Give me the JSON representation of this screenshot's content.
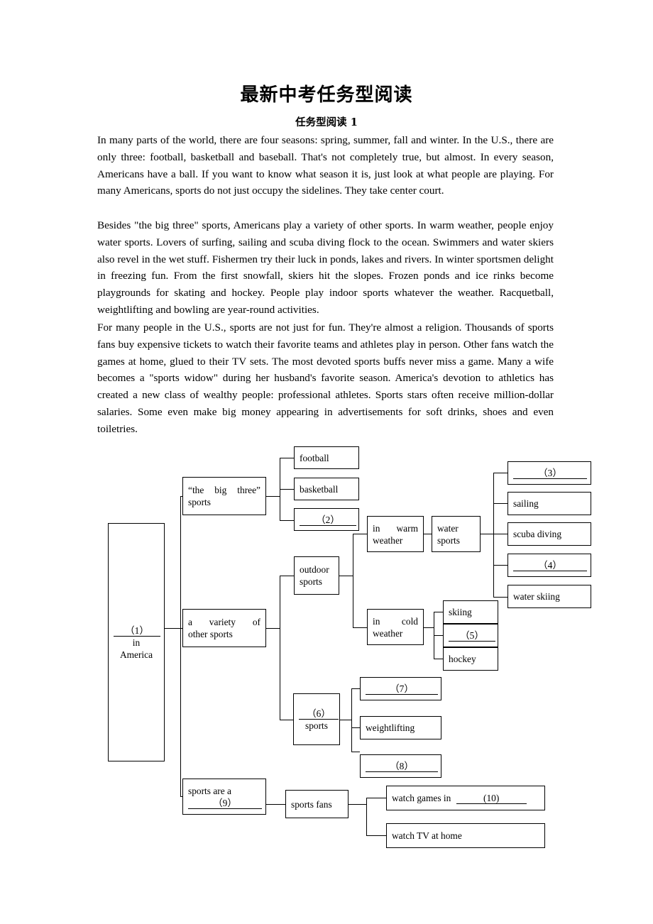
{
  "document": {
    "title": "最新中考任务型阅读",
    "subtitle": "任务型阅读 1",
    "paragraphs": [
      "In many parts of the world, there are four seasons: spring, summer, fall and winter. In the U.S., there are only three: football, basketball and baseball. That's not completely true, but almost. In every season, Americans have a ball. If you want to know what season it is, just look at what people are playing. For many Americans, sports do not just occupy the sidelines. They take center court.",
      "Besides \"the big three\" sports, Americans play a variety of other sports. In warm weather, people enjoy water sports. Lovers of surfing, sailing and scuba diving flock to the ocean. Swimmers and water skiers also revel in the wet stuff. Fishermen try their luck in ponds, lakes and rivers. In winter sportsmen delight in freezing fun. From the first snowfall, skiers hit the slopes. Frozen ponds and ice rinks become playgrounds for skating and hockey. People play indoor sports whatever the weather. Racquetball, weightlifting and bowling are year-round activities.",
      "For many people in the U.S., sports are not just for fun. They're almost a religion. Thousands of sports fans buy expensive tickets to watch their favorite teams and athletes play in person. Other fans watch the games at home, glued to their TV sets. The most devoted sports buffs never miss a game. Many a wife becomes a \"sports widow\" during her husband's favorite season. America's devotion to athletics has created a new class of wealthy people: professional athletes. Sports stars often receive million-dollar salaries. Some even make big money appearing in advertisements for soft drinks, shoes and even toiletries."
    ]
  },
  "diagram": {
    "root": {
      "blank": "（1）",
      "line2": "in",
      "line3": "America"
    },
    "big_three": {
      "line1": "“the  big  three”",
      "line2": "sports"
    },
    "big_three_children": {
      "football": "football",
      "basketball": "basketball",
      "blank2": "（2）"
    },
    "variety": {
      "line1": "a   variety   of",
      "line2": "other sports"
    },
    "outdoor": {
      "line1": "outdoor",
      "line2": "sports"
    },
    "warm": {
      "line1": "in   warm",
      "line2": "weather"
    },
    "water_sports": {
      "line1": "water",
      "line2": "sports"
    },
    "water_children": {
      "blank3": "（3）",
      "sailing": "sailing",
      "scuba": "scuba diving",
      "blank4": "（4）",
      "water_skiing": "water skiing"
    },
    "cold": {
      "line1": "in    cold",
      "line2": "weather"
    },
    "cold_children": {
      "skiing": "skiing",
      "blank5": "（5）",
      "hockey": "hockey"
    },
    "indoor": {
      "blank6": "（6）",
      "line2": "sports"
    },
    "indoor_children": {
      "blank7": "（7）",
      "weightlifting": "weightlifting",
      "blank8": "（8）"
    },
    "religion": {
      "line1": "sports are a",
      "blank9": "（9）"
    },
    "fans": {
      "label": "sports  fans"
    },
    "fans_children": {
      "watch_games_prefix": "watch games in",
      "blank10": "(10)",
      "watch_tv": "watch TV at home"
    }
  },
  "colors": {
    "ink": "#000000",
    "page": "#ffffff"
  }
}
